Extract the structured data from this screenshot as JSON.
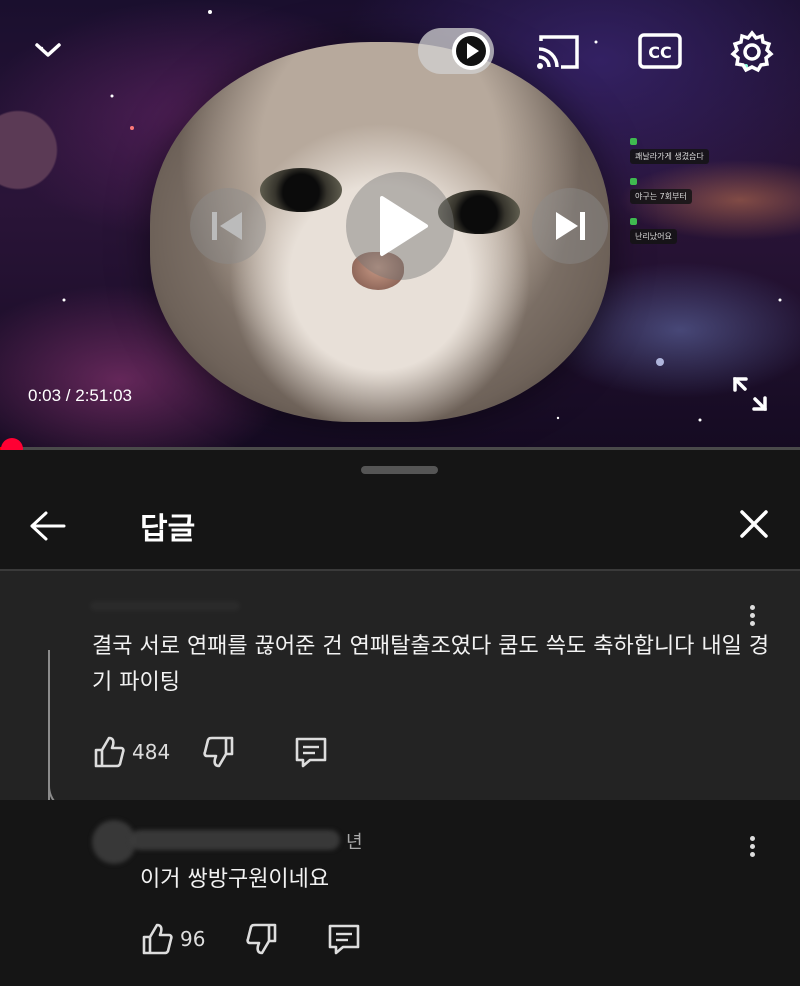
{
  "player": {
    "current_time": "0:03",
    "duration": "2:51:03",
    "time_display": "0:03 / 2:51:03",
    "progress": 0.0003,
    "autoplay_on": true,
    "chat_overlay": [
      "쾌날라가게 생겼습다",
      "야구는 7회부터",
      "난리났어요"
    ]
  },
  "panel": {
    "title": "답글"
  },
  "parent_comment": {
    "text": "결국 서로 연패를 끊어준 건 연패탈출조였다 쿰도 쓱도 축하합니다 내일 경기 파이팅",
    "likes": "484"
  },
  "reply_comment": {
    "time_fragment": "년",
    "text": "이거 쌍방구원이네요",
    "likes": "96"
  },
  "colors": {
    "accent": "#ff0000",
    "panel_bg": "#151515",
    "highlight_bg": "#232323"
  },
  "icons": [
    "collapse-chevron-icon",
    "autoplay-toggle",
    "cast-icon",
    "captions-icon",
    "settings-icon",
    "previous-icon",
    "play-icon",
    "next-icon",
    "fullscreen-icon",
    "back-arrow-icon",
    "close-icon",
    "more-vert-icon",
    "thumb-up-icon",
    "thumb-down-icon",
    "reply-icon"
  ]
}
